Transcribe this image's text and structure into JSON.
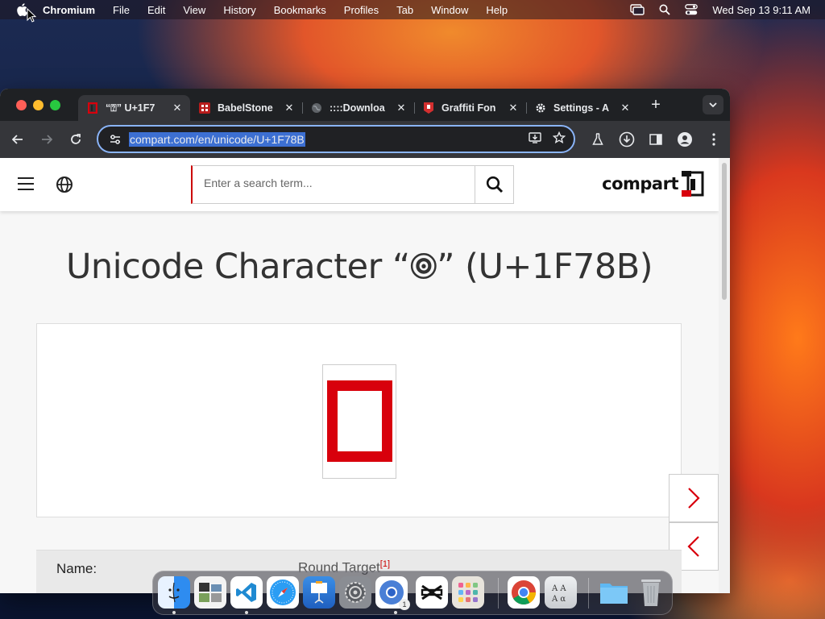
{
  "menubar": {
    "items": [
      "Chromium",
      "File",
      "Edit",
      "View",
      "History",
      "Bookmarks",
      "Profiles",
      "Tab",
      "Window",
      "Help"
    ],
    "datetime": "Wed Sep 13  9:11 AM"
  },
  "tabs": [
    {
      "title": "“⍰” U+1F7",
      "favicon": "compart-icon"
    },
    {
      "title": "BabelStone",
      "favicon": "babelstone-icon"
    },
    {
      "title": "::::Downloa",
      "favicon": "globe-icon"
    },
    {
      "title": "Graffiti Fon",
      "favicon": "graffiti-icon"
    },
    {
      "title": "Settings - A",
      "favicon": "gear-icon"
    }
  ],
  "address": {
    "url": "compart.com/en/unicode/U+1F78B"
  },
  "site": {
    "search_placeholder": "Enter a search term...",
    "logo_text": "compart",
    "headline": "Unicode Character “🞋” (U+1F78B)",
    "name_label": "Name:",
    "name_value": "Round Target",
    "footnote": "[1]"
  },
  "colors": {
    "accent": "#d8000c",
    "omnibox_focus": "#8ab4f8",
    "selection": "#3c6fd2"
  },
  "dock": [
    "finder-icon",
    "photo-browser-icon",
    "vscode-icon",
    "safari-icon",
    "keynote-icon",
    "system-settings-icon",
    "chromium-icon",
    "capcut-icon",
    "launchpad-icon",
    "chrome-icon",
    "font-book-icon",
    "folder-icon",
    "trash-icon"
  ],
  "dock_badge": "1"
}
